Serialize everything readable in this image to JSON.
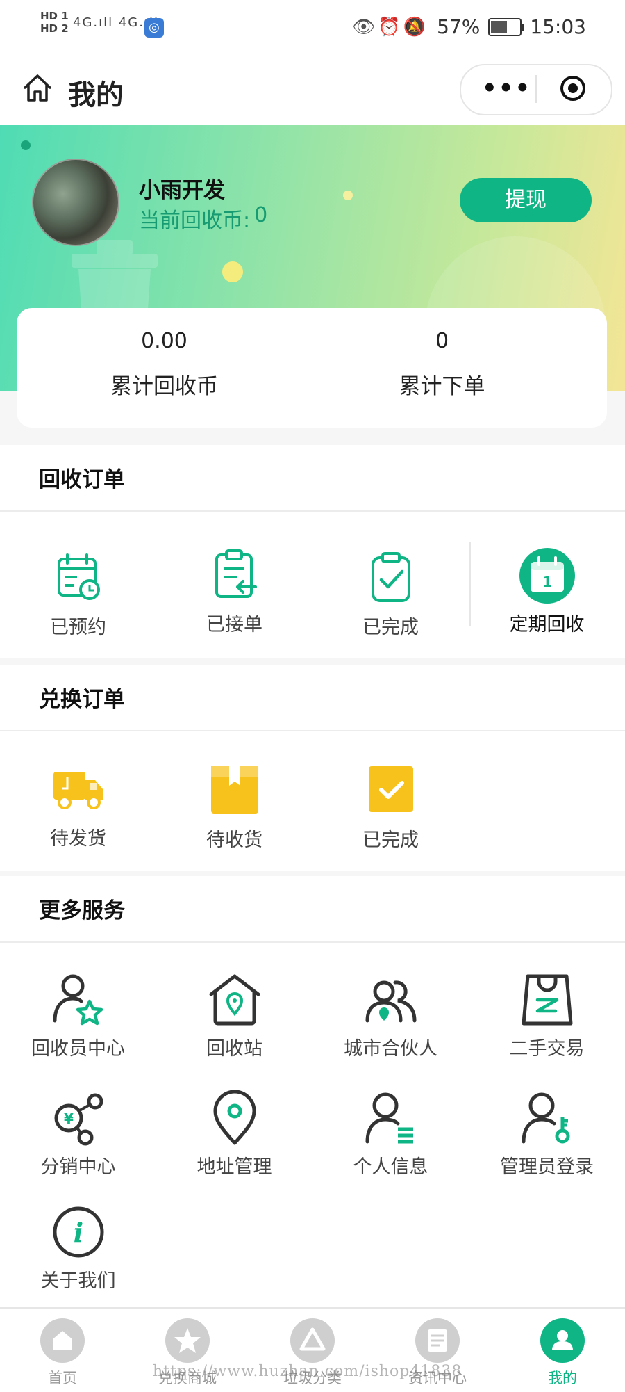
{
  "status_bar": {
    "hd1": "HD 1",
    "hd2": "HD 2",
    "signal": "4G.ıll 4G.ıll",
    "battery_percent": "57%",
    "time": "15:03",
    "battery_level": 0.57
  },
  "nav": {
    "title": "我的",
    "more_icon": "more-dots-icon",
    "target_icon": "close-target-icon"
  },
  "profile": {
    "name": "小雨开发",
    "coins_label": "当前回收币:",
    "coins_value": "0",
    "withdraw_label": "提现"
  },
  "stats": [
    {
      "value": "0.00",
      "label": "累计回收币"
    },
    {
      "value": "0",
      "label": "累计下单"
    }
  ],
  "recycle_orders": {
    "title": "回收订单",
    "items": [
      {
        "label": "已预约",
        "icon": "calendar-clock-icon"
      },
      {
        "label": "已接单",
        "icon": "clipboard-arrow-icon"
      },
      {
        "label": "已完成",
        "icon": "clipboard-check-icon"
      },
      {
        "label": "定期回收",
        "icon": "calendar-day-icon",
        "badge": "1"
      }
    ]
  },
  "exchange_orders": {
    "title": "兑换订单",
    "items": [
      {
        "label": "待发货",
        "icon": "delivery-truck-icon"
      },
      {
        "label": "待收货",
        "icon": "package-box-icon"
      },
      {
        "label": "已完成",
        "icon": "check-square-icon"
      }
    ]
  },
  "more_services": {
    "title": "更多服务",
    "items": [
      {
        "label": "回收员中心",
        "icon": "user-star-icon"
      },
      {
        "label": "回收站",
        "icon": "house-pin-icon"
      },
      {
        "label": "城市合伙人",
        "icon": "users-pin-icon"
      },
      {
        "label": "二手交易",
        "icon": "shopping-bag-icon"
      },
      {
        "label": "分销中心",
        "icon": "yuan-share-icon"
      },
      {
        "label": "地址管理",
        "icon": "location-pin-icon"
      },
      {
        "label": "个人信息",
        "icon": "user-list-icon"
      },
      {
        "label": "管理员登录",
        "icon": "user-key-icon"
      },
      {
        "label": "关于我们",
        "icon": "info-icon",
        "glyph": "i"
      }
    ]
  },
  "tabbar": [
    {
      "label": "首页",
      "icon": "home-tab-icon"
    },
    {
      "label": "兑换商城",
      "icon": "star-tab-icon"
    },
    {
      "label": "垃圾分类",
      "icon": "recycle-tab-icon"
    },
    {
      "label": "资讯中心",
      "icon": "news-tab-icon"
    },
    {
      "label": "我的",
      "icon": "user-tab-icon",
      "active": true
    }
  ],
  "watermark": "https://www.huzhan.com/ishop41838",
  "colors": {
    "accent": "#10b586",
    "exchange_yellow": "#f7c21c",
    "icon_dark": "#333333"
  }
}
